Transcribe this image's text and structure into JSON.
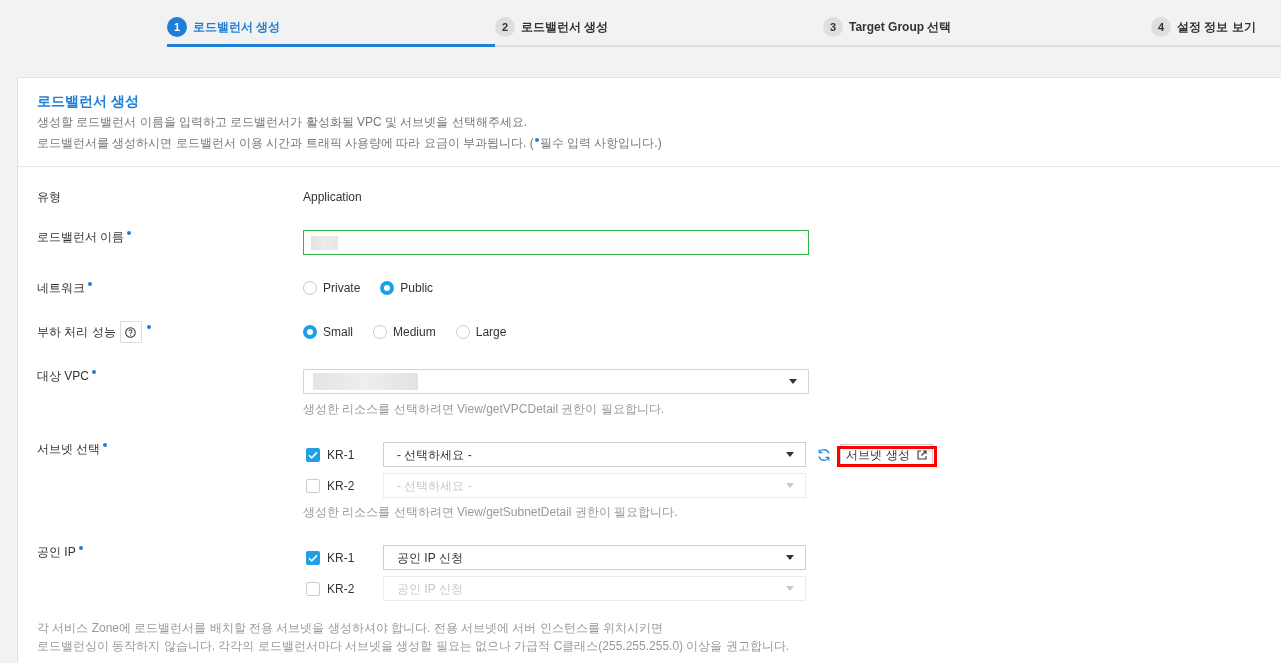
{
  "steps": [
    {
      "number": "1",
      "label": "로드밸런서 생성",
      "selected": true
    },
    {
      "number": "2",
      "label": "로드밸런서 생성",
      "selected": false
    },
    {
      "number": "3",
      "label": "Target Group 선택",
      "selected": false
    },
    {
      "number": "4",
      "label": "설정 정보 보기",
      "selected": false
    }
  ],
  "section": {
    "title": "로드밸런서 생성",
    "description": "생성할 로드밸런서 이름을 입력하고 로드밸런서가 활성화될 VPC 및 서브넷을 선택해주세요.",
    "billing_note": "로드밸런서를 생성하시면 로드밸런서 이용 시간과 트래픽 사용량에 따라 요금이 부과됩니다. (",
    "required_note": "필수 입력 사항입니다.)"
  },
  "form": [
    {
      "kind": "text",
      "label": "유형",
      "value": "Application"
    },
    {
      "kind": "input",
      "label": "로드밸런서 이름",
      "required": true,
      "redacted": true,
      "valid": true
    },
    {
      "kind": "radio",
      "label": "네트워크",
      "required": true,
      "options": [
        {
          "label": "Private",
          "selected": false
        },
        {
          "label": "Public",
          "selected": true
        }
      ]
    },
    {
      "kind": "radio",
      "label": "부하 처리 성능",
      "required": true,
      "help": true,
      "options": [
        {
          "label": "Small",
          "selected": true
        },
        {
          "label": "Medium",
          "selected": false
        },
        {
          "label": "Large",
          "selected": false
        }
      ]
    },
    {
      "kind": "select",
      "label": "대상 VPC",
      "required": true,
      "redacted": true,
      "hint": "생성한 리소스를 선택하려면 View/getVPCDetail 권한이 필요합니다."
    },
    {
      "kind": "zones",
      "label": "서브넷 선택",
      "required": true,
      "zones": [
        {
          "name": "KR-1",
          "checked": true,
          "disabled": false,
          "value": "- 선택하세요 -"
        },
        {
          "name": "KR-2",
          "checked": false,
          "disabled": true,
          "value": "- 선택하세요 -"
        }
      ],
      "refresh": true,
      "action": {
        "label": "서브넷 생성",
        "highlighted": true
      },
      "hint": "생성한 리소스를 선택하려면 View/getSubnetDetail 권한이 필요합니다."
    },
    {
      "kind": "zones",
      "label": "공인 IP",
      "required": true,
      "zones": [
        {
          "name": "KR-1",
          "checked": true,
          "disabled": false,
          "value": "공인 IP 신청"
        },
        {
          "name": "KR-2",
          "checked": false,
          "disabled": true,
          "value": "공인 IP 신청"
        }
      ]
    }
  ],
  "note": "각 서비스 Zone에 로드밸런서를 배치할 전용 서브넷을 생성하셔야 합니다. 전용 서브넷에 서버 인스턴스를 위치시키면\n로드밸런싱이 동작하지 않습니다. 각각의 로드밸런서마다 서브넷을 생성할 필요는 없으나 가급적 C클래스(255.255.255.0) 이상을 권고합니다."
}
